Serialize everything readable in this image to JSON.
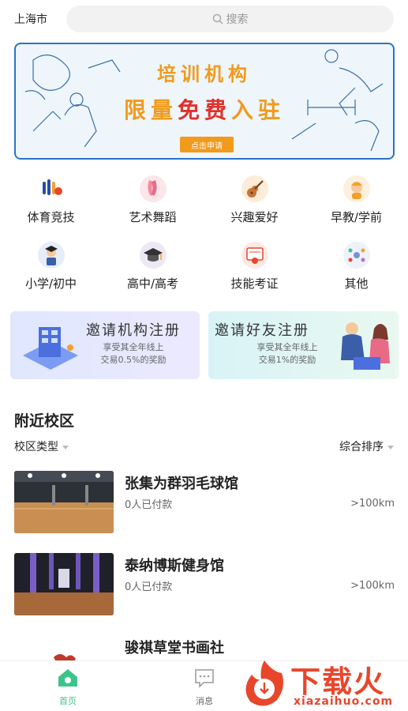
{
  "header": {
    "city": "上海市",
    "search_placeholder": "搜索"
  },
  "banner": {
    "line1": "培训机构",
    "line2_prefix": "限量",
    "line2_highlight": "免费",
    "line2_suffix": "入驻",
    "button": "点击申请"
  },
  "categories": [
    {
      "label": "体育竞技",
      "icon": "sports-icon"
    },
    {
      "label": "艺术舞蹈",
      "icon": "dance-icon"
    },
    {
      "label": "兴趣爱好",
      "icon": "guitar-icon"
    },
    {
      "label": "早教/学前",
      "icon": "baby-icon"
    },
    {
      "label": "小学/初中",
      "icon": "student-icon"
    },
    {
      "label": "高中/高考",
      "icon": "graduation-cap-icon"
    },
    {
      "label": "技能考证",
      "icon": "certificate-icon"
    },
    {
      "label": "其他",
      "icon": "other-icon"
    }
  ],
  "invites": [
    {
      "title": "邀请机构注册",
      "line1": "享受其全年线上",
      "line2": "交易0.5%的奖励"
    },
    {
      "title": "邀请好友注册",
      "line1": "享受其全年线上",
      "line2": "交易1%的奖励"
    }
  ],
  "nearby": {
    "title": "附近校区",
    "filter_type": "校区类型",
    "filter_sort": "综合排序"
  },
  "venues": [
    {
      "name": "张集为群羽毛球馆",
      "paid": "0人已付款",
      "distance": ">100km"
    },
    {
      "name": "泰纳博斯健身馆",
      "paid": "0人已付款",
      "distance": ">100km"
    },
    {
      "name": "骏祺草堂书画社",
      "paid": "",
      "distance": ""
    }
  ],
  "bottom_nav": {
    "home": "首页",
    "messages": "消息"
  },
  "watermark": {
    "title": "下载火",
    "url": "xiazaihuo.com"
  },
  "colors": {
    "accent": "#3cc48a",
    "banner_orange": "#f29a1c",
    "banner_red": "#e0322b",
    "watermark_red": "#e8462b"
  }
}
